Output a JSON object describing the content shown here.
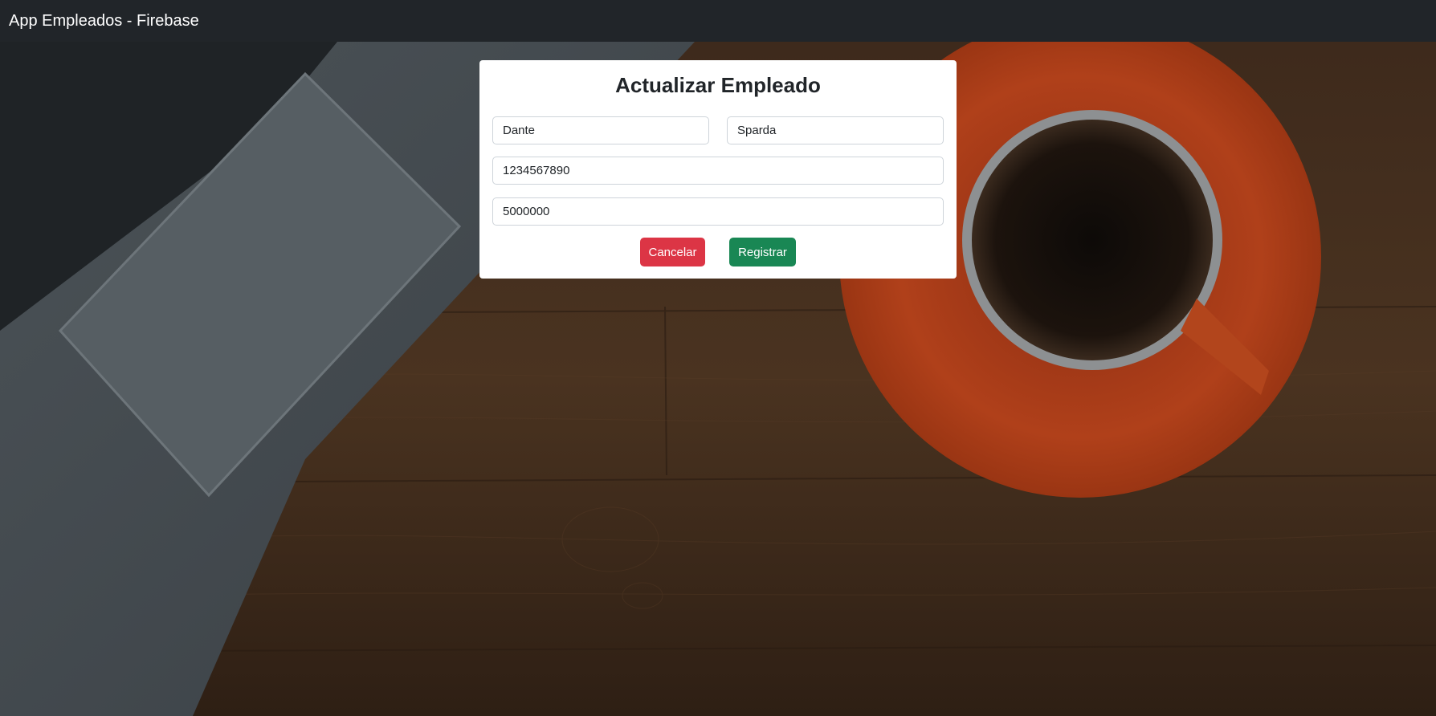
{
  "navbar": {
    "brand": "App Empleados - Firebase"
  },
  "form": {
    "title": "Actualizar Empleado",
    "fields": {
      "nombre": "Dante",
      "apellido": "Sparda",
      "documento": "1234567890",
      "salario": "5000000"
    },
    "buttons": {
      "cancel": "Cancelar",
      "submit": "Registrar"
    }
  },
  "colors": {
    "navbar": "#212529",
    "cancel": "#dc3545",
    "submit": "#198754"
  }
}
